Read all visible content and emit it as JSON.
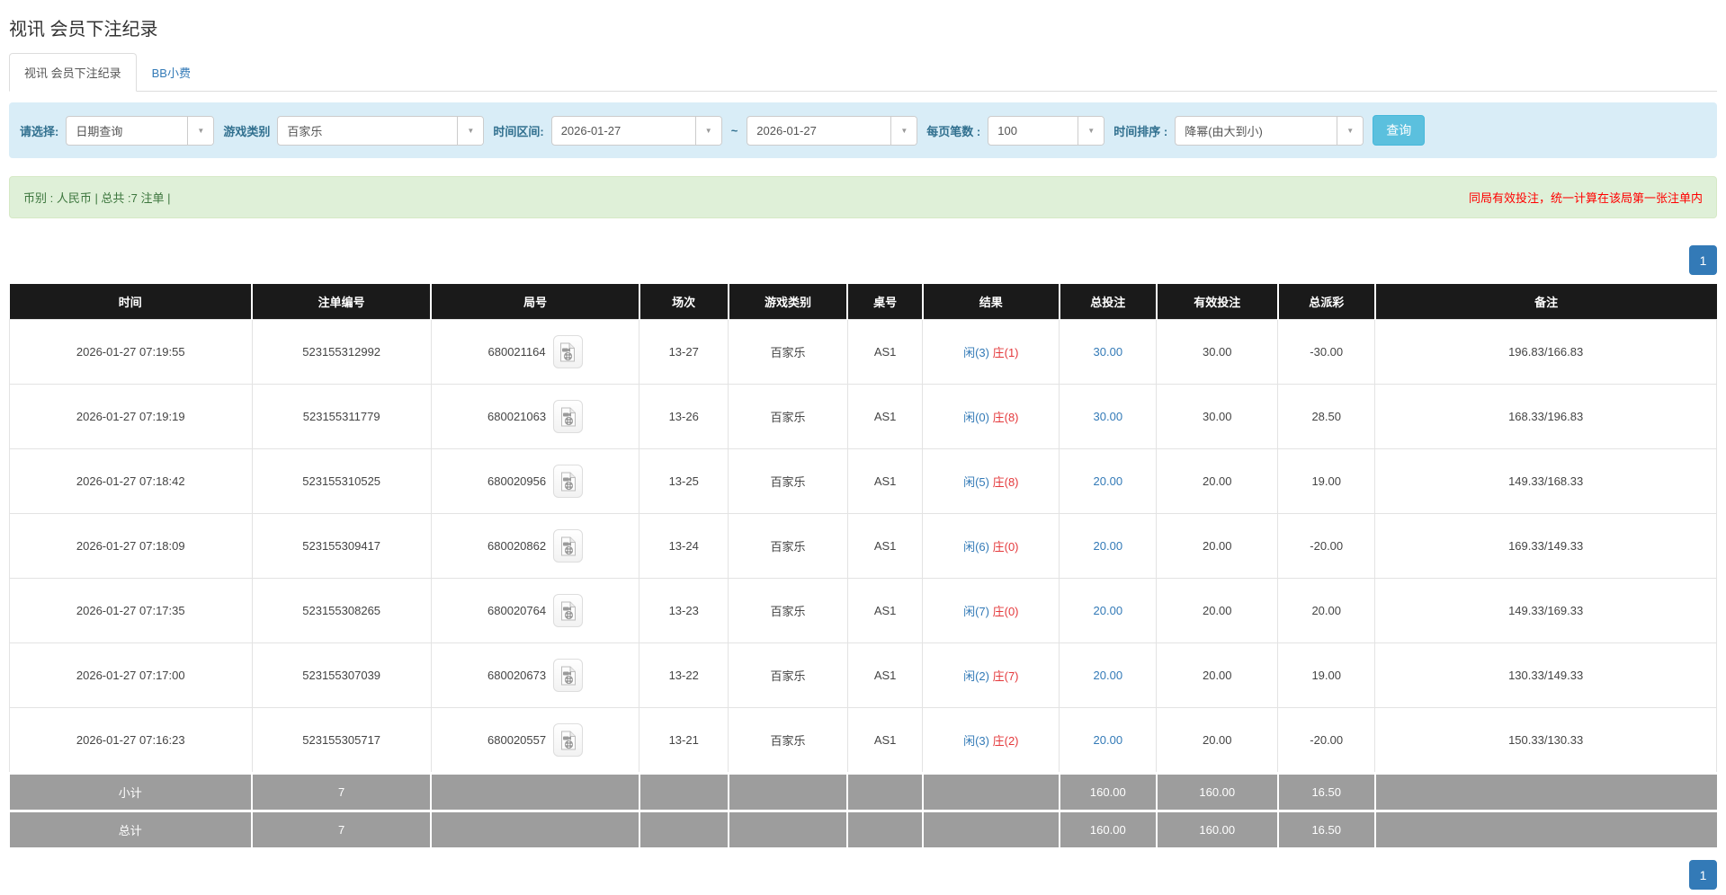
{
  "page": {
    "title": "视讯 会员下注纪录"
  },
  "tabs": {
    "items": [
      {
        "label": "视讯 会员下注纪录",
        "active": true
      },
      {
        "label": "BB小费",
        "active": false
      }
    ]
  },
  "filters": {
    "select_type": {
      "label": "请选择:",
      "value": "日期查询"
    },
    "game_type": {
      "label": "游戏类别",
      "value": "百家乐"
    },
    "date_range": {
      "label": "时间区间:",
      "from": "2026-01-27",
      "separator": "~",
      "to": "2026-01-27"
    },
    "page_size": {
      "label": "每页笔数 :",
      "value": "100"
    },
    "time_sort": {
      "label": "时间排序 :",
      "value": "降幂(由大到小)"
    },
    "query_button": "查询"
  },
  "info_bar": {
    "summary": "币别 : 人民币 | 总共 :7 注单 |",
    "note": "同局有效投注，统一计算在该局第一张注单内"
  },
  "pagination": {
    "page": "1"
  },
  "table": {
    "columns": [
      "时间",
      "注单编号",
      "局号",
      "场次",
      "游戏类别",
      "桌号",
      "结果",
      "总投注",
      "有效投注",
      "总派彩",
      "备注"
    ],
    "rows": [
      {
        "time": "2026-01-27 07:19:55",
        "bet_no": "523155312992",
        "round_no": "680021164",
        "session": "13-27",
        "game": "百家乐",
        "table_no": "AS1",
        "result_player": "闲(3)",
        "result_banker": "庄(1)",
        "total_bet": "30.00",
        "valid_bet": "30.00",
        "payout": "-30.00",
        "note": "196.83/166.83"
      },
      {
        "time": "2026-01-27 07:19:19",
        "bet_no": "523155311779",
        "round_no": "680021063",
        "session": "13-26",
        "game": "百家乐",
        "table_no": "AS1",
        "result_player": "闲(0)",
        "result_banker": "庄(8)",
        "total_bet": "30.00",
        "valid_bet": "30.00",
        "payout": "28.50",
        "note": "168.33/196.83"
      },
      {
        "time": "2026-01-27 07:18:42",
        "bet_no": "523155310525",
        "round_no": "680020956",
        "session": "13-25",
        "game": "百家乐",
        "table_no": "AS1",
        "result_player": "闲(5)",
        "result_banker": "庄(8)",
        "total_bet": "20.00",
        "valid_bet": "20.00",
        "payout": "19.00",
        "note": "149.33/168.33"
      },
      {
        "time": "2026-01-27 07:18:09",
        "bet_no": "523155309417",
        "round_no": "680020862",
        "session": "13-24",
        "game": "百家乐",
        "table_no": "AS1",
        "result_player": "闲(6)",
        "result_banker": "庄(0)",
        "total_bet": "20.00",
        "valid_bet": "20.00",
        "payout": "-20.00",
        "note": "169.33/149.33"
      },
      {
        "time": "2026-01-27 07:17:35",
        "bet_no": "523155308265",
        "round_no": "680020764",
        "session": "13-23",
        "game": "百家乐",
        "table_no": "AS1",
        "result_player": "闲(7)",
        "result_banker": "庄(0)",
        "total_bet": "20.00",
        "valid_bet": "20.00",
        "payout": "20.00",
        "note": "149.33/169.33"
      },
      {
        "time": "2026-01-27 07:17:00",
        "bet_no": "523155307039",
        "round_no": "680020673",
        "session": "13-22",
        "game": "百家乐",
        "table_no": "AS1",
        "result_player": "闲(2)",
        "result_banker": "庄(7)",
        "total_bet": "20.00",
        "valid_bet": "20.00",
        "payout": "19.00",
        "note": "130.33/149.33"
      },
      {
        "time": "2026-01-27 07:16:23",
        "bet_no": "523155305717",
        "round_no": "680020557",
        "session": "13-21",
        "game": "百家乐",
        "table_no": "AS1",
        "result_player": "闲(3)",
        "result_banker": "庄(2)",
        "total_bet": "20.00",
        "valid_bet": "20.00",
        "payout": "-20.00",
        "note": "150.33/130.33"
      }
    ],
    "summary": [
      {
        "label": "小计",
        "count": "7",
        "total_bet": "160.00",
        "valid_bet": "160.00",
        "payout": "16.50"
      },
      {
        "label": "总计",
        "count": "7",
        "total_bet": "160.00",
        "valid_bet": "160.00",
        "payout": "16.50"
      }
    ]
  },
  "icons": {
    "dropdown_arrow": "▼",
    "video_file": "video-file-icon"
  },
  "colors": {
    "accent": "#337ab7",
    "query_button": "#5bc0de",
    "player_blue": "#337ab7",
    "banker_red": "#e4393c",
    "negative_red": "#ff0000",
    "header_bg": "#1a1a1a",
    "summary_bg": "#9d9d9d",
    "filter_bg": "#d9edf7",
    "info_bg": "#dff0d8",
    "info_text": "#3c763d",
    "note_red": "#ff0000"
  }
}
